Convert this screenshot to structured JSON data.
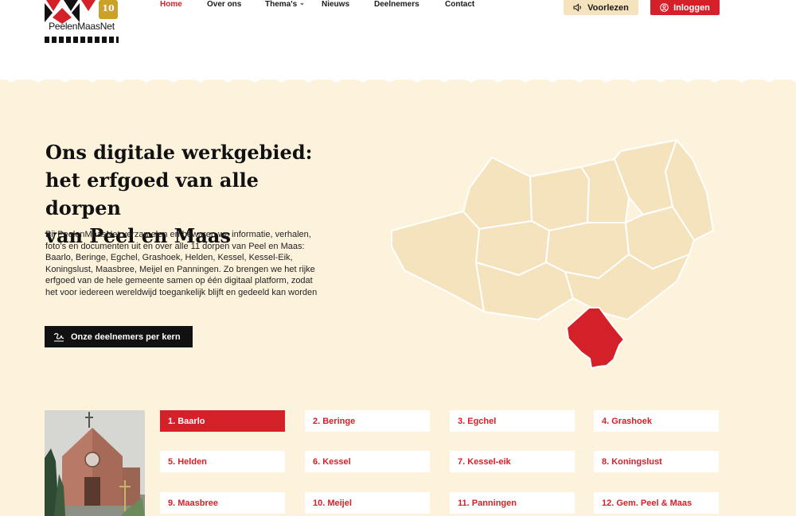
{
  "logo": {
    "text": "PeelenMaasNet",
    "badge": "10"
  },
  "nav": {
    "items": [
      {
        "label": "Home",
        "active": true
      },
      {
        "label": "Over ons"
      },
      {
        "label": "Thema's",
        "has_dropdown": true
      },
      {
        "label": "Nieuws"
      },
      {
        "label": "Deelnemers"
      },
      {
        "label": "Contact"
      }
    ]
  },
  "header_actions": {
    "read_aloud": "Voorlezen",
    "login": "Inloggen"
  },
  "hero": {
    "title_lines": [
      "Ons digitale werkgebied:",
      "het erfgoed van alle dorpen",
      "van Peel en Maas"
    ],
    "body": "Bij PeelenMaasNet verzamelen en bewaren we informatie, verhalen, foto’s en documenten uit en over alle 11 dorpen van Peel en Maas: Baarlo, Beringe, Egchel, Grashoek, Helden, Kessel, Kessel-Eik, Koningslust, Maasbree, Meijel en Panningen. Zo brengen we het rijke erfgoed van de hele gemeente samen op één digitaal platform, zodat het voor iedereen wereldwijd toegankelijk blijft en gedeeld kan worden",
    "cta": "Onze deelnemers per kern"
  },
  "colors": {
    "accent": "#d42129",
    "cream": "#fdf3dd",
    "map_fill": "#f4e3bd",
    "dark": "#111111"
  },
  "kernen": [
    "1. Baarlo",
    "2. Beringe",
    "3. Egchel",
    "4. Grashoek",
    "5. Helden",
    "6. Kessel",
    "7. Kessel-eik",
    "8. Koningslust",
    "9. Maasbree",
    "10. Meijel",
    "11. Panningen",
    "12. Gem. Peel & Maas"
  ],
  "active_kern": 0
}
